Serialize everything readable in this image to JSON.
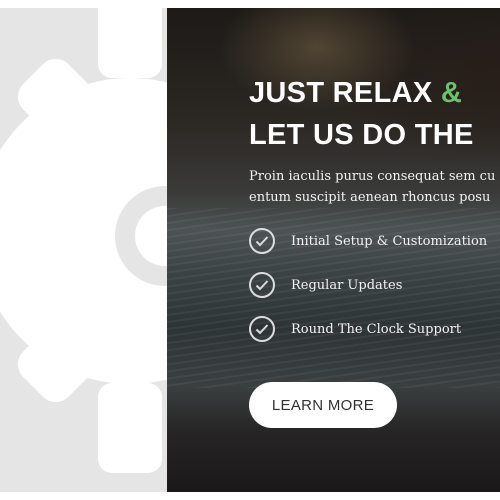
{
  "hero": {
    "title_line1_text": "JUST RELAX",
    "title_line1_accent": "&",
    "title_line2": "LET US DO THE",
    "description_line1": "Proin iaculis purus consequat sem cu",
    "description_line2": "entum suscipit aenean rhoncus posu",
    "features": [
      {
        "label": "Initial Setup & Customization",
        "icon": "check-circle-icon"
      },
      {
        "label": "Regular Updates",
        "icon": "check-circle-icon"
      },
      {
        "label": "Round The Clock Support",
        "icon": "check-circle-icon"
      }
    ],
    "button_label": "LEARN MORE"
  },
  "decoration": {
    "icon": "gear-icon"
  },
  "colors": {
    "accent": "#6cc070",
    "left_panel_bg": "#e5e5e5",
    "gear": "#ffffff",
    "text_light": "#ffffff",
    "button_bg": "#ffffff",
    "button_text": "#333333"
  }
}
